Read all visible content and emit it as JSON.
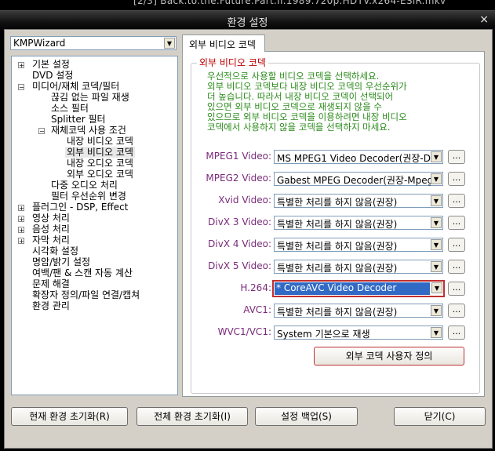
{
  "window": {
    "top_title": "[2/3] Back.to.the.Future.Part.II.1989.720p.HDTV.x264-ESiR.mkv",
    "dialog_title": "환경 설정",
    "close_glyph": "×"
  },
  "preset": {
    "value": "KMPWizard"
  },
  "tree": {
    "items": [
      {
        "label": "기본 설정"
      },
      {
        "label": "DVD 설정"
      },
      {
        "label": "미디어/재체 코덱/필터"
      },
      {
        "label": "끊김 없는 파일 재생"
      },
      {
        "label": "소스 필터"
      },
      {
        "label": "Splitter 필터"
      },
      {
        "label": "재체코덱 사용 조건"
      },
      {
        "label": "내장 비디오 코덱"
      },
      {
        "label": "외부 비디오 코덱"
      },
      {
        "label": "내장 오디오 코덱"
      },
      {
        "label": "외부 오디오 코덱"
      },
      {
        "label": "다중 오디오 처리"
      },
      {
        "label": "필터 우선순위 변경"
      },
      {
        "label": "플러그인 - DSP, Effect"
      },
      {
        "label": "영상 처리"
      },
      {
        "label": "음성 처리"
      },
      {
        "label": "자막 처리"
      },
      {
        "label": "시각화 설정"
      },
      {
        "label": "명암/밝기 설정"
      },
      {
        "label": "여백/팬 & 스캔 자동 계산"
      },
      {
        "label": "문제 해결"
      },
      {
        "label": "확장자 정의/파일 연결/캡쳐"
      },
      {
        "label": "환경 관리"
      }
    ]
  },
  "tab": {
    "label": "외부 비디오 코덱"
  },
  "group": {
    "title": "외부 비디오 코덱",
    "desc": [
      "우선적으로 사용할 비디오 코덱을 선택하세요.",
      "외부 비디오 코덱보다 내장 비디오 코덱의 우선순위가",
      "더 높습니다. 따라서 내장 비디오 코덱이 선택되어",
      "있으면 외부 비디오 코덱으로 재생되지 않을 수",
      "있으므로 외부 비디오 코덱을 이용하려면 내장 비디오",
      "코덱에서 사용하지 않을 코덱을 선택하지 마세요."
    ]
  },
  "codecs": [
    {
      "label": "MPEG1 Video:",
      "value": "MS MPEG1 Video Decoder(권장-D"
    },
    {
      "label": "MPEG2 Video:",
      "value": "Gabest MPEG Decoder(권장-Mpeg"
    },
    {
      "label": "Xvid Video:",
      "value": "특별한 처리를 하지 않음(권장)"
    },
    {
      "label": "DivX 3 Video:",
      "value": "특별한 처리를 하지 않음(권장)"
    },
    {
      "label": "DivX 4 Video:",
      "value": "특별한 처리를 하지 않음(권장)"
    },
    {
      "label": "DivX 5 Video:",
      "value": "특별한 처리를 하지 않음(권장)"
    },
    {
      "label": "H.264:",
      "value": "* CoreAVC Video Decoder"
    },
    {
      "label": "AVC1:",
      "value": "특별한 처리를 하지 않음(권장)"
    },
    {
      "label": "WVC1/VC1:",
      "value": "System 기본으로 재생"
    }
  ],
  "dots_label": "...",
  "custom_button": "외부 코덱 사용자 정의",
  "buttons": {
    "reset_current": "현재 환경 초기화(R)",
    "reset_all": "전체 환경 초기화(I)",
    "backup": "설정 백업(S)",
    "close": "닫기(C)"
  },
  "colors": {
    "accent_label": "#7a2a7a",
    "group_title": "#c00000",
    "desc_text": "#2a8a1a",
    "selection": "#316ac5"
  }
}
